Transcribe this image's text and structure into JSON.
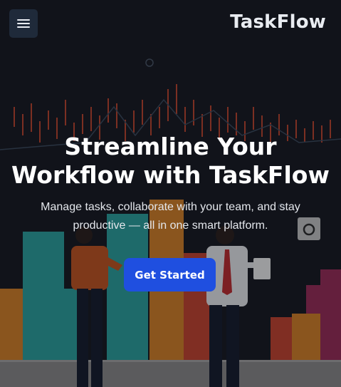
{
  "brand": {
    "name": "TaskFlow"
  },
  "nav": {
    "menu_icon": "hamburger-menu-icon"
  },
  "hero": {
    "headline_line1": "Streamline Your",
    "headline_line2": "Workflow with TaskFlow",
    "subtext": "Manage tasks, collaborate with your team, and stay productive — all in one smart platform.",
    "cta_label": "Get Started",
    "background": "dashboard-analytics-illustration"
  },
  "colors": {
    "accent": "#1f4fe0",
    "menu_button": "#1f2a3a",
    "text": "#ffffff"
  }
}
